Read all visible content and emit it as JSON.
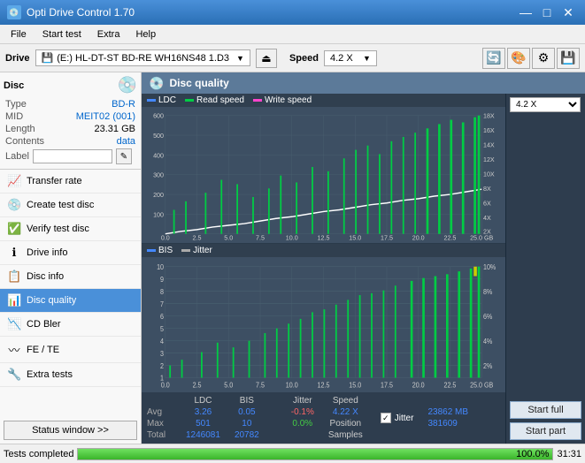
{
  "app": {
    "title": "Opti Drive Control 1.70",
    "icon": "💿"
  },
  "title_controls": {
    "minimize": "—",
    "maximize": "□",
    "close": "✕"
  },
  "menu": {
    "items": [
      "File",
      "Start test",
      "Extra",
      "Help"
    ]
  },
  "drive_toolbar": {
    "drive_label": "Drive",
    "drive_value": "(E:) HL-DT-ST BD-RE WH16NS48 1.D3",
    "speed_label": "Speed",
    "speed_value": "4.2 X"
  },
  "disc_panel": {
    "title": "Disc",
    "type_label": "Type",
    "type_value": "BD-R",
    "mid_label": "MID",
    "mid_value": "MEIT02 (001)",
    "length_label": "Length",
    "length_value": "23.31 GB",
    "contents_label": "Contents",
    "contents_value": "data",
    "label_label": "Label",
    "label_value": ""
  },
  "sidebar_nav": [
    {
      "id": "transfer-rate",
      "label": "Transfer rate",
      "icon": "📈"
    },
    {
      "id": "create-test-disc",
      "label": "Create test disc",
      "icon": "💿"
    },
    {
      "id": "verify-test-disc",
      "label": "Verify test disc",
      "icon": "✅"
    },
    {
      "id": "drive-info",
      "label": "Drive info",
      "icon": "ℹ️"
    },
    {
      "id": "disc-info",
      "label": "Disc info",
      "icon": "📋"
    },
    {
      "id": "disc-quality",
      "label": "Disc quality",
      "icon": "📊",
      "active": true
    },
    {
      "id": "cd-bler",
      "label": "CD Bler",
      "icon": "📉"
    },
    {
      "id": "fe-te",
      "label": "FE / TE",
      "icon": "〰"
    },
    {
      "id": "extra-tests",
      "label": "Extra tests",
      "icon": "🔧"
    }
  ],
  "chart_title": "Disc quality",
  "chart1": {
    "legend": [
      {
        "id": "ldc",
        "label": "LDC",
        "color": "#4488ff"
      },
      {
        "id": "read",
        "label": "Read speed",
        "color": "#00cc44"
      },
      {
        "id": "write",
        "label": "Write speed",
        "color": "#ff44cc"
      }
    ],
    "y_axis": [
      "600",
      "500",
      "400",
      "300",
      "200",
      "100"
    ],
    "y_axis_right": [
      "18X",
      "16X",
      "14X",
      "12X",
      "10X",
      "8X",
      "6X",
      "4X",
      "2X"
    ],
    "x_axis": [
      "0.0",
      "2.5",
      "5.0",
      "7.5",
      "10.0",
      "12.5",
      "15.0",
      "17.5",
      "20.0",
      "22.5",
      "25.0 GB"
    ]
  },
  "chart2": {
    "legend": [
      {
        "id": "bis",
        "label": "BIS",
        "color": "#4488ff"
      },
      {
        "id": "jitter",
        "label": "Jitter",
        "color": "#aaaaaa"
      }
    ],
    "y_axis": [
      "10",
      "9",
      "8",
      "7",
      "6",
      "5",
      "4",
      "3",
      "2",
      "1"
    ],
    "y_axis_right": [
      "10%",
      "8%",
      "6%",
      "4%",
      "2%"
    ],
    "x_axis": [
      "0.0",
      "2.5",
      "5.0",
      "7.5",
      "10.0",
      "12.5",
      "15.0",
      "17.5",
      "20.0",
      "22.5",
      "25.0 GB"
    ]
  },
  "stats": {
    "columns": [
      "LDC",
      "BIS",
      "",
      "Jitter",
      "Speed"
    ],
    "avg_label": "Avg",
    "avg_ldc": "3.26",
    "avg_bis": "0.05",
    "avg_jitter": "-0.1%",
    "max_label": "Max",
    "max_ldc": "501",
    "max_bis": "10",
    "max_jitter": "0.0%",
    "total_label": "Total",
    "total_ldc": "1246081",
    "total_bis": "20782",
    "speed_label": "Speed",
    "speed_value": "4.22 X",
    "position_label": "Position",
    "position_value": "23862 MB",
    "samples_label": "Samples",
    "samples_value": "381609",
    "jitter_checked": true,
    "speed_dropdown": "4.2 X"
  },
  "action_buttons": {
    "start_full": "Start full",
    "start_part": "Start part"
  },
  "status_bar": {
    "text": "Tests completed",
    "progress": 100,
    "progress_text": "100.0%",
    "time": "31:31"
  }
}
